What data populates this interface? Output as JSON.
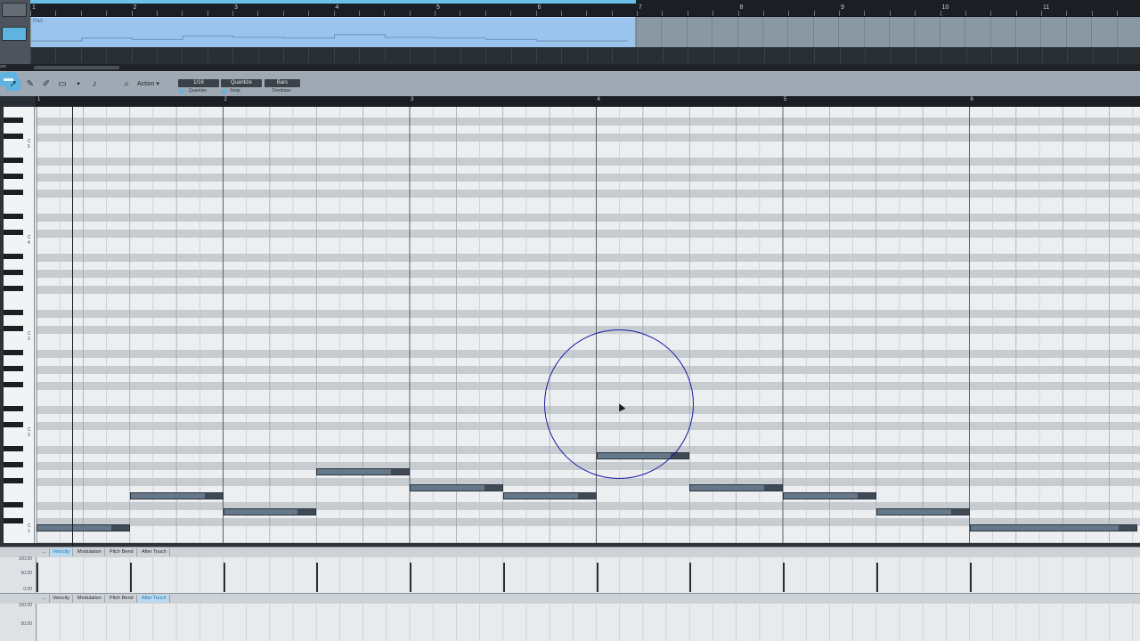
{
  "arrangement": {
    "ruler_numbers": [
      "1",
      "2",
      "3",
      "4",
      "5",
      "6",
      "7",
      "8",
      "9",
      "10",
      "11"
    ],
    "clip_name": "Part",
    "scroll_label": "um"
  },
  "toolbar": {
    "tools": [
      "arrow-tool",
      "pencil-tool",
      "eraser-tool",
      "paint-tool",
      "mute-tool",
      "listen-tool"
    ],
    "zoom_icon": "magnifier-icon",
    "action_label": "Action",
    "quantize": {
      "value": "1/16",
      "label": "Quantize"
    },
    "snap": {
      "value": "Quantize",
      "label": "Snap"
    },
    "timebase": {
      "value": "Bars",
      "label": "Timebase"
    }
  },
  "piano_roll": {
    "ruler_numbers": [
      "1",
      "2",
      "3",
      "4",
      "5",
      "6"
    ],
    "key_labels": [
      "C 5",
      "C 4",
      "C 3",
      "C 2",
      "C 1"
    ],
    "notes": [
      {
        "bar_start": 1.0,
        "length_bars": 0.5,
        "pitch_row": 0
      },
      {
        "bar_start": 1.5,
        "length_bars": 0.5,
        "pitch_row": 4
      },
      {
        "bar_start": 2.0,
        "length_bars": 0.5,
        "pitch_row": 2
      },
      {
        "bar_start": 2.5,
        "length_bars": 0.5,
        "pitch_row": 7
      },
      {
        "bar_start": 3.0,
        "length_bars": 0.5,
        "pitch_row": 5
      },
      {
        "bar_start": 3.5,
        "length_bars": 0.5,
        "pitch_row": 4
      },
      {
        "bar_start": 4.0,
        "length_bars": 0.5,
        "pitch_row": 9
      },
      {
        "bar_start": 4.5,
        "length_bars": 0.5,
        "pitch_row": 5
      },
      {
        "bar_start": 5.0,
        "length_bars": 0.5,
        "pitch_row": 4
      },
      {
        "bar_start": 5.5,
        "length_bars": 0.5,
        "pitch_row": 2
      },
      {
        "bar_start": 6.0,
        "length_bars": 0.9,
        "pitch_row": 0
      }
    ]
  },
  "lane1": {
    "tabs": [
      "...",
      "Velocity",
      "Modulation",
      "Pitch Bend",
      "After Touch"
    ],
    "active_tab": "Velocity",
    "scale": [
      "100.00",
      "50.00",
      "0.00"
    ]
  },
  "lane2": {
    "tabs": [
      "...",
      "Velocity",
      "Modulation",
      "Pitch Bend",
      "After Touch"
    ],
    "active_tab": "After Touch",
    "scale": [
      "100.00",
      "50.00"
    ]
  },
  "colors": {
    "accent": "#5fb3e0",
    "note": "#66778a",
    "clip": "#9ac4ee",
    "highlight_circle": "#1a1aa8"
  }
}
